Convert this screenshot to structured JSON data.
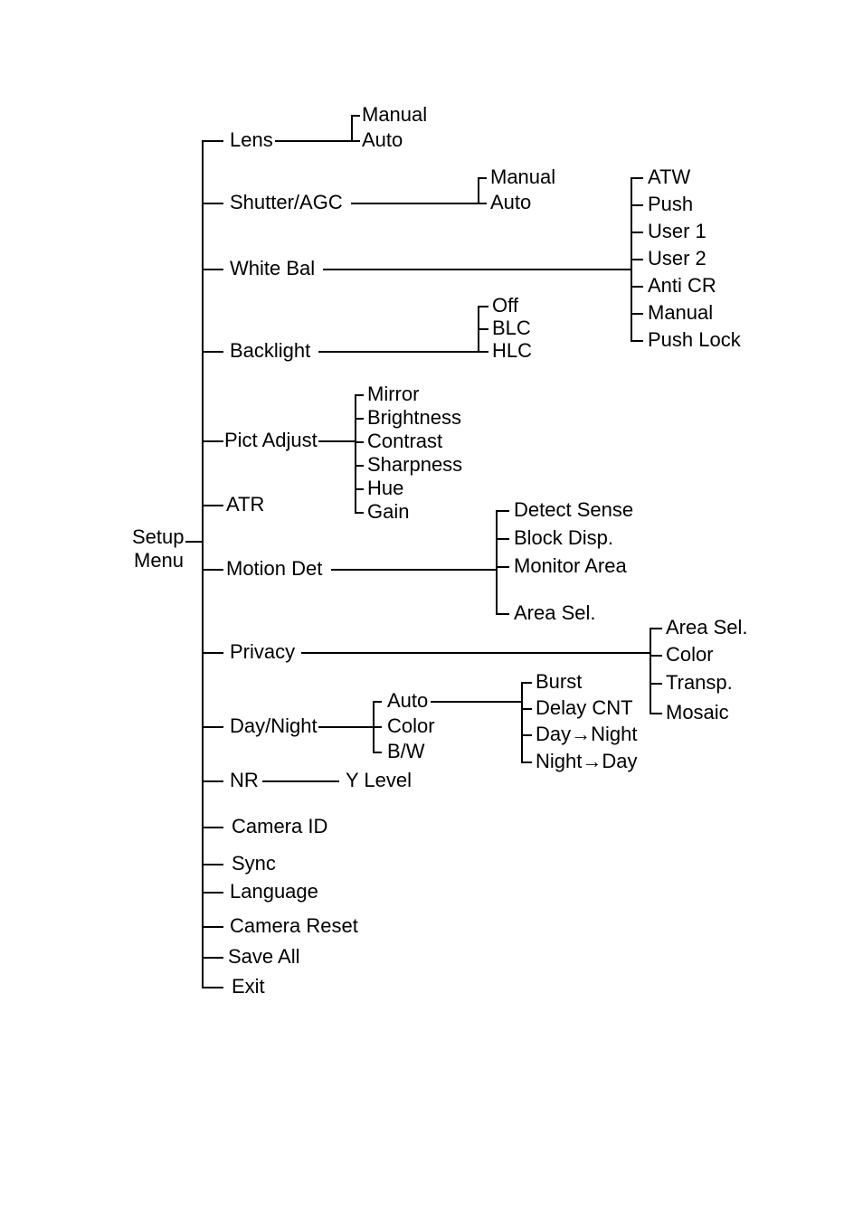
{
  "root": {
    "line1": "Setup",
    "line2": "Menu"
  },
  "level1": {
    "lens": "Lens",
    "shutter": "Shutter/AGC",
    "whitebal": "White Bal",
    "backlight": "Backlight",
    "pictadjust": "Pict Adjust",
    "atr": "ATR",
    "motiondet": "Motion Det",
    "privacy": "Privacy",
    "daynight": "Day/Night",
    "nr": "NR",
    "cameraid": "Camera ID",
    "sync": "Sync",
    "language": "Language",
    "camerareset": "Camera Reset",
    "saveall": "Save All",
    "exit": "Exit"
  },
  "lens_children": {
    "manual": "Manual",
    "auto": "Auto"
  },
  "shutter_children": {
    "manual": "Manual",
    "auto": "Auto"
  },
  "whitebal_children": {
    "atw": "ATW",
    "push": "Push",
    "user1": "User 1",
    "user2": "User 2",
    "anticr": "Anti CR",
    "manual": "Manual",
    "pushlock": "Push Lock"
  },
  "backlight_children": {
    "off": "Off",
    "blc": "BLC",
    "hlc": "HLC"
  },
  "pictadjust_children": {
    "mirror": "Mirror",
    "brightness": "Brightness",
    "contrast": "Contrast",
    "sharpness": "Sharpness",
    "hue": "Hue",
    "gain": "Gain"
  },
  "motiondet_children": {
    "detectsense": "Detect Sense",
    "blockdisp": "Block Disp.",
    "monitorarea": "Monitor Area",
    "areasel": "Area Sel."
  },
  "privacy_children": {
    "areasel": "Area Sel.",
    "color": "Color",
    "transp": "Transp.",
    "mosaic": "Mosaic"
  },
  "daynight_children": {
    "auto": "Auto",
    "color": "Color",
    "bw": "B/W"
  },
  "daynight_auto_children": {
    "burst": "Burst",
    "delaycnt": "Delay CNT",
    "daytonight": "Day→Night",
    "nighttoday": "Night→Day"
  },
  "nr_children": {
    "ylevel": "Y Level"
  }
}
